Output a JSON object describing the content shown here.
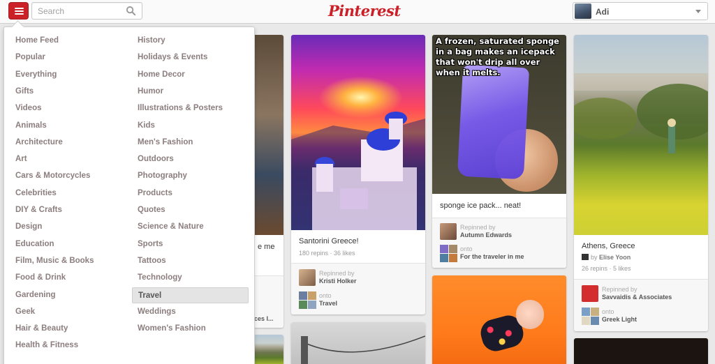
{
  "header": {
    "search_placeholder": "Search",
    "logo": "Pinterest",
    "user_name": "Adi",
    "accent": "#cb2027"
  },
  "menu": {
    "left_column": [
      "Home Feed",
      "Popular",
      "Everything",
      "Gifts",
      "Videos",
      "Animals",
      "Architecture",
      "Art",
      "Cars & Motorcycles",
      "Celebrities",
      "DIY & Crafts",
      "Design",
      "Education",
      "Film, Music & Books",
      "Food & Drink",
      "Gardening",
      "Geek",
      "Hair & Beauty",
      "Health & Fitness"
    ],
    "right_column": [
      "History",
      "Holidays & Events",
      "Home Decor",
      "Humor",
      "Illustrations & Posters",
      "Kids",
      "Men's Fashion",
      "Outdoors",
      "Photography",
      "Products",
      "Quotes",
      "Science & Nature",
      "Sports",
      "Tattoos",
      "Technology",
      "Travel",
      "Weddings",
      "Women's Fashion"
    ],
    "selected": "Travel"
  },
  "pins": {
    "partial": {
      "desc_fragment": "e me",
      "attr_fragment": "ces I..."
    },
    "santorini": {
      "description": "Santorini Greece!",
      "repins": "180 repins",
      "likes": "36 likes",
      "repinned_by_label": "Repinned by",
      "repinned_by": "Kristi Holker",
      "onto_label": "onto",
      "board": "Travel"
    },
    "sponge": {
      "meme_text": "A frozen, saturated sponge in a bag makes an icepack that won't drip all over when it melts.",
      "description": "sponge ice pack... neat!",
      "repinned_by_label": "Repinned by",
      "repinned_by": "Autumn Edwards",
      "onto_label": "onto",
      "board": "For the traveler in me"
    },
    "athens": {
      "description": "Athens, Greece",
      "by_label": "by",
      "by_user": "Elise Yoon",
      "repins": "26 repins",
      "likes": "5 likes",
      "repinned_by_label": "Repinned by",
      "repinned_by": "Savvaidis & Associates",
      "onto_label": "onto",
      "board": "Greek Light"
    }
  }
}
